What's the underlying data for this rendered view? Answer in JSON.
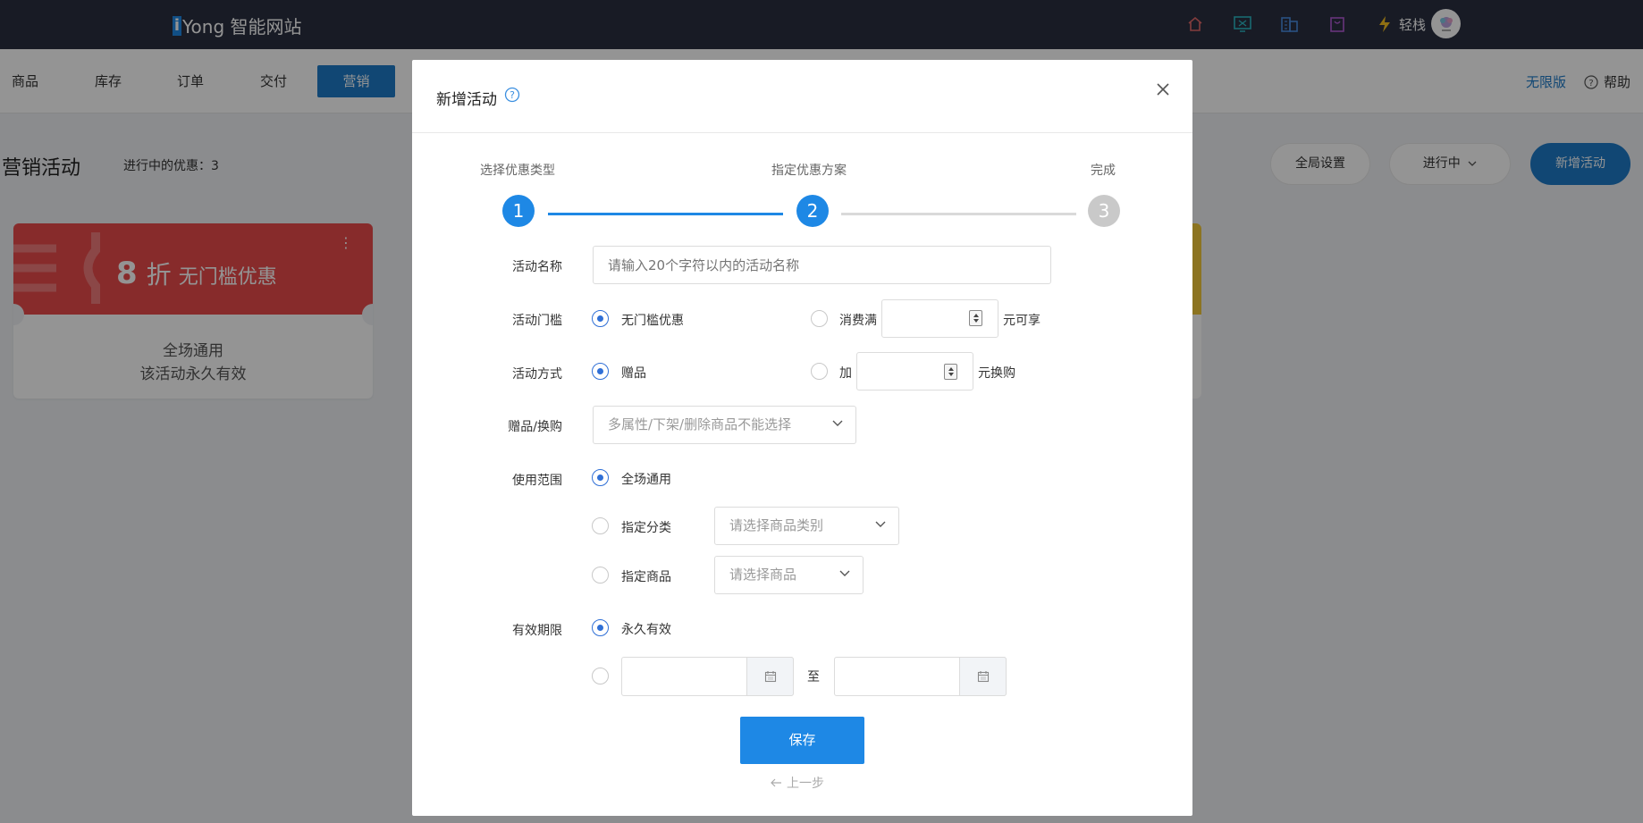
{
  "app": {
    "brand_i": "i",
    "brand_rest": "Yong 智能网站",
    "user_name": "轻栈",
    "top_icons": [
      "home-icon",
      "monitor-icon",
      "building-icon",
      "shopping-bag-icon",
      "lightning-icon"
    ]
  },
  "nav": {
    "items": [
      {
        "label": "商品"
      },
      {
        "label": "库存"
      },
      {
        "label": "订单"
      },
      {
        "label": "交付"
      },
      {
        "label": "营销",
        "active": true
      }
    ],
    "edition": "无限版",
    "help": "帮助"
  },
  "page": {
    "title": "营销活动",
    "ongoing_label": "进行中的优惠：3",
    "global_settings": "全局设置",
    "status_filter": "进行中",
    "new_activity": "新增活动"
  },
  "promo_card": {
    "discount_number": "8",
    "discount_unit": "折",
    "discount_text": "无门槛优惠",
    "scope": "全场通用",
    "validity": "该活动永久有效",
    "color": "#e84b4b"
  },
  "modal": {
    "title": "新增活动",
    "steps": [
      {
        "label": "选择优惠类型",
        "number": "1",
        "state": "done"
      },
      {
        "label": "指定优惠方案",
        "number": "2",
        "state": "active"
      },
      {
        "label": "完成",
        "number": "3",
        "state": "pending"
      }
    ],
    "form": {
      "name_label": "活动名称",
      "name_placeholder": "请输入20个字符以内的活动名称",
      "threshold_label": "活动门槛",
      "threshold_opt1": "无门槛优惠",
      "threshold_opt2_prefix": "消费满",
      "threshold_opt2_suffix": "元可享",
      "method_label": "活动方式",
      "method_opt1": "赠品",
      "method_opt2_prefix": "加",
      "method_opt2_suffix": "元换购",
      "gift_label": "赠品/换购",
      "gift_placeholder": "多属性/下架/删除商品不能选择",
      "scope_label": "使用范围",
      "scope_opt1": "全场通用",
      "scope_opt2": "指定分类",
      "scope_opt2_placeholder": "请选择商品类别",
      "scope_opt3": "指定商品",
      "scope_opt3_placeholder": "请选择商品",
      "validity_label": "有效期限",
      "validity_opt1": "永久有效",
      "date_separator": "至"
    },
    "save": "保存",
    "back": "上一步"
  },
  "colors": {
    "primary": "#1e88e5",
    "nav_active": "#1e7ac8",
    "topbar": "#2a3040",
    "radio_active": "#2f6fd6"
  }
}
